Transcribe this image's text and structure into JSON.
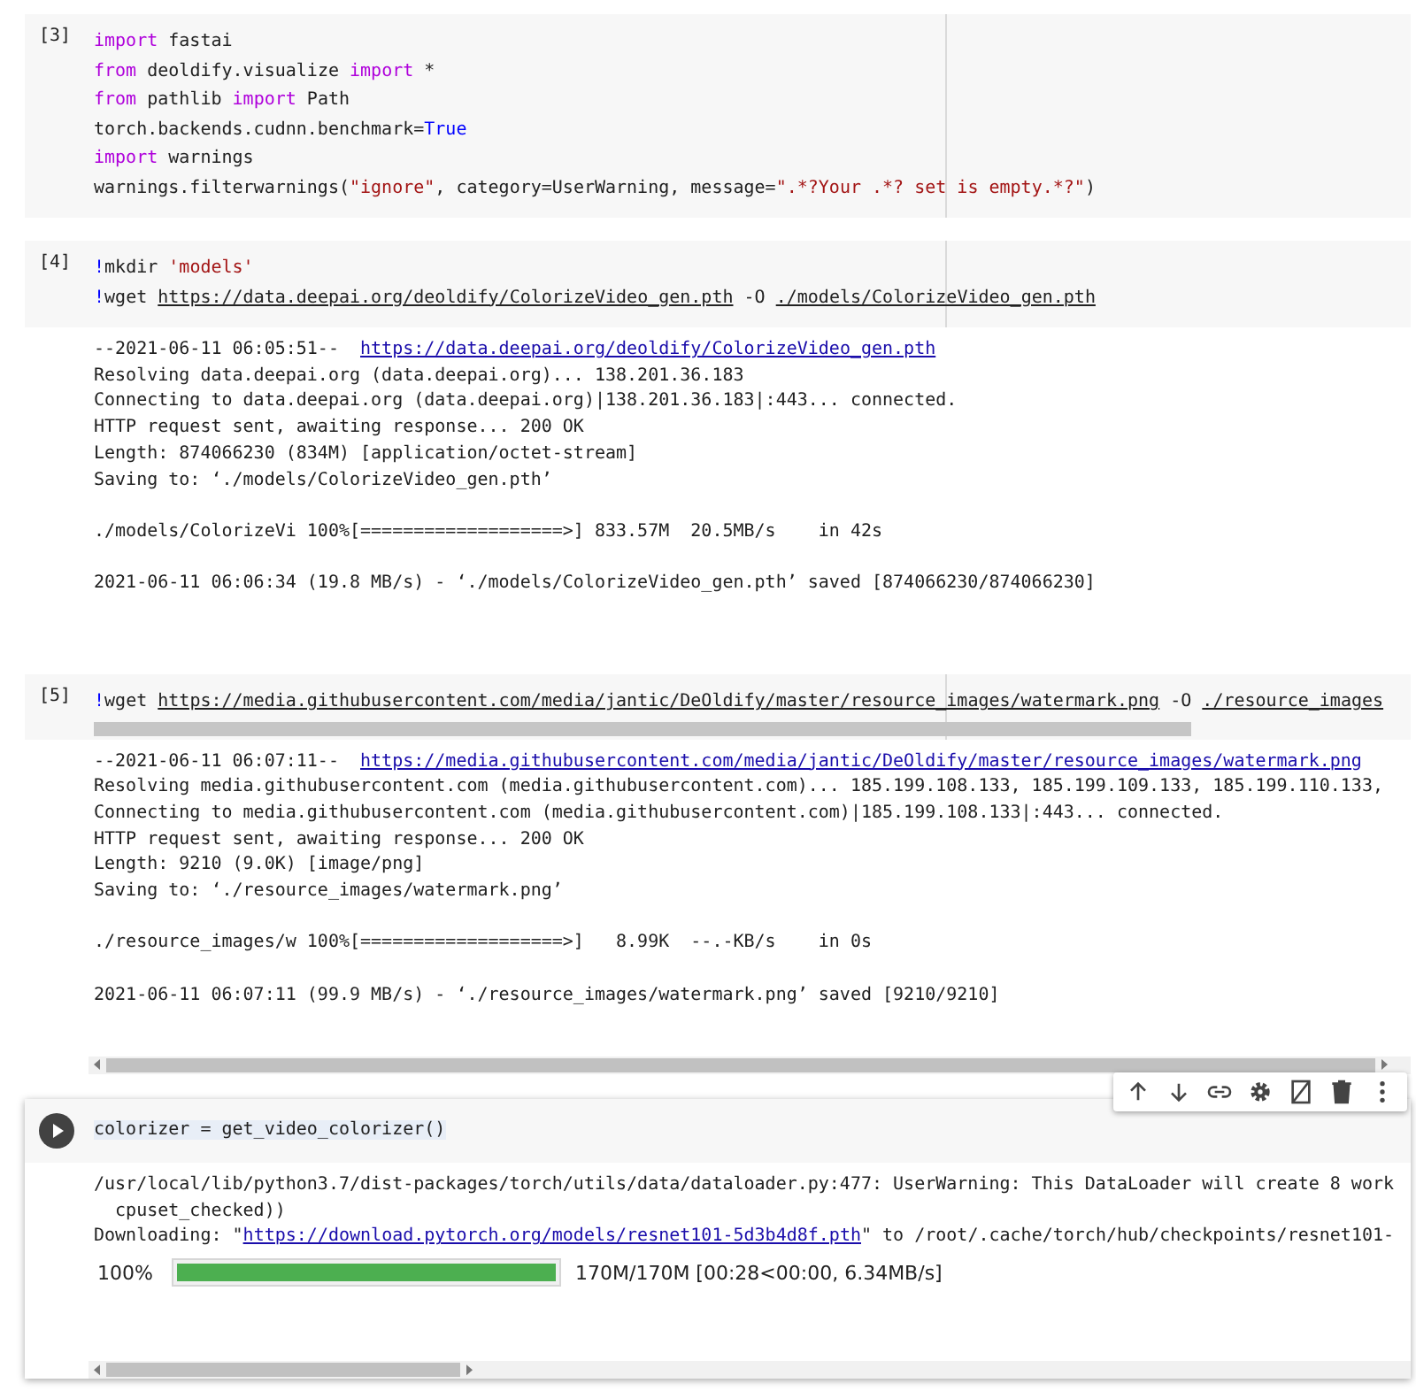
{
  "cells": [
    {
      "count": "[3]",
      "focused": false,
      "code": [
        [
          {
            "kind": "keyword",
            "s": "import"
          },
          {
            "kind": "plain",
            "s": " fastai"
          }
        ],
        [
          {
            "kind": "keyword",
            "s": "from"
          },
          {
            "kind": "plain",
            "s": " deoldify.visualize "
          },
          {
            "kind": "keyword",
            "s": "import"
          },
          {
            "kind": "plain",
            "s": " *"
          }
        ],
        [
          {
            "kind": "keyword",
            "s": "from"
          },
          {
            "kind": "plain",
            "s": " pathlib "
          },
          {
            "kind": "keyword",
            "s": "import"
          },
          {
            "kind": "plain",
            "s": " Path"
          }
        ],
        [
          {
            "kind": "plain",
            "s": "torch.backends.cudnn.benchmark="
          },
          {
            "kind": "constant",
            "s": "True"
          }
        ],
        [
          {
            "kind": "keyword",
            "s": "import"
          },
          {
            "kind": "plain",
            "s": " warnings"
          }
        ],
        [
          {
            "kind": "plain",
            "s": "warnings.filterwarnings("
          },
          {
            "kind": "string",
            "s": "\"ignore\""
          },
          {
            "kind": "plain",
            "s": ", category=UserWarning, message="
          },
          {
            "kind": "string",
            "s": "\".*?Your .*? set is empty.*?\""
          },
          {
            "kind": "plain",
            "s": ")"
          }
        ]
      ]
    },
    {
      "count": "[4]",
      "focused": false,
      "code": [
        [
          {
            "kind": "constant",
            "s": "!"
          },
          {
            "kind": "plain",
            "s": "mkdir "
          },
          {
            "kind": "string",
            "s": "'models'"
          }
        ],
        [
          {
            "kind": "constant",
            "s": "!"
          },
          {
            "kind": "plain",
            "s": "wget "
          },
          {
            "kind": "path",
            "s": "https://data.deepai.org/deoldify/ColorizeVideo_gen.pth"
          },
          {
            "kind": "plain",
            "s": " -O "
          },
          {
            "kind": "path",
            "s": "./models/ColorizeVideo_gen.pth"
          }
        ]
      ],
      "output": [
        [
          [
            {
              "kind": "plain",
              "s": "--2021-06-11 06:05:51--  "
            },
            {
              "kind": "link",
              "s": "https://data.deepai.org/deoldify/ColorizeVideo_gen.pth"
            }
          ],
          [
            {
              "kind": "plain",
              "s": "Resolving data.deepai.org (data.deepai.org)... 138.201.36.183"
            }
          ],
          [
            {
              "kind": "plain",
              "s": "Connecting to data.deepai.org (data.deepai.org)|138.201.36.183|:443... connected."
            }
          ],
          [
            {
              "kind": "plain",
              "s": "HTTP request sent, awaiting response... 200 OK"
            }
          ],
          [
            {
              "kind": "plain",
              "s": "Length: 874066230 (834M) [application/octet-stream]"
            }
          ],
          [
            {
              "kind": "plain",
              "s": "Saving to: ‘./models/ColorizeVideo_gen.pth’"
            }
          ]
        ],
        [
          [
            {
              "kind": "plain",
              "s": "./models/ColorizeVi 100%[===================>] 833.57M  20.5MB/s    in 42s"
            }
          ]
        ],
        [
          [
            {
              "kind": "plain",
              "s": "2021-06-11 06:06:34 (19.8 MB/s) - ‘./models/ColorizeVideo_gen.pth’ saved [874066230/874066230]"
            }
          ]
        ]
      ]
    },
    {
      "count": "[5]",
      "focused": false,
      "code_scrollbar": true,
      "output_scrollbar": true,
      "code": [
        [
          {
            "kind": "constant",
            "s": "!"
          },
          {
            "kind": "plain",
            "s": "wget "
          },
          {
            "kind": "path",
            "s": "https://media.githubusercontent.com/media/jantic/DeOldify/master/resource_images/watermark.png"
          },
          {
            "kind": "plain",
            "s": " -O "
          },
          {
            "kind": "path",
            "s": "./resource_images"
          }
        ]
      ],
      "output": [
        [
          [
            {
              "kind": "plain",
              "s": "--2021-06-11 06:07:11--  "
            },
            {
              "kind": "link",
              "s": "https://media.githubusercontent.com/media/jantic/DeOldify/master/resource_images/watermark.png"
            }
          ],
          [
            {
              "kind": "plain",
              "s": "Resolving media.githubusercontent.com (media.githubusercontent.com)... 185.199.108.133, 185.199.109.133, 185.199.110.133,"
            }
          ],
          [
            {
              "kind": "plain",
              "s": "Connecting to media.githubusercontent.com (media.githubusercontent.com)|185.199.108.133|:443... connected."
            }
          ],
          [
            {
              "kind": "plain",
              "s": "HTTP request sent, awaiting response... 200 OK"
            }
          ],
          [
            {
              "kind": "plain",
              "s": "Length: 9210 (9.0K) [image/png]"
            }
          ],
          [
            {
              "kind": "plain",
              "s": "Saving to: ‘./resource_images/watermark.png’"
            }
          ]
        ],
        [
          [
            {
              "kind": "plain",
              "s": "./resource_images/w 100%[===================>]   8.99K  --.-KB/s    in 0s"
            }
          ]
        ],
        [
          [
            {
              "kind": "plain",
              "s": "2021-06-11 06:07:11 (99.9 MB/s) - ‘./resource_images/watermark.png’ saved [9210/9210]"
            }
          ]
        ]
      ]
    },
    {
      "focused": true,
      "output_scrollbar": true,
      "code": [
        [
          {
            "kind": "plain",
            "s": "colorizer = get_video_colorizer()"
          }
        ]
      ],
      "output": [
        [
          [
            {
              "kind": "plain",
              "s": "/usr/local/lib/python3.7/dist-packages/torch/utils/data/dataloader.py:477: UserWarning: This DataLoader will create 8 work"
            }
          ],
          [
            {
              "kind": "plain",
              "s": "  cpuset_checked))"
            }
          ],
          [
            {
              "kind": "plain",
              "s": "Downloading: \""
            },
            {
              "kind": "link",
              "s": "https://download.pytorch.org/models/resnet101-5d3b4d8f.pth"
            },
            {
              "kind": "plain",
              "s": "\" to /root/.cache/torch/hub/checkpoints/resnet101-"
            }
          ]
        ]
      ],
      "progress": {
        "label": "100%",
        "level": 1,
        "text": "170M/170M [00:28<00:00, 6.34MB/s]"
      }
    }
  ]
}
